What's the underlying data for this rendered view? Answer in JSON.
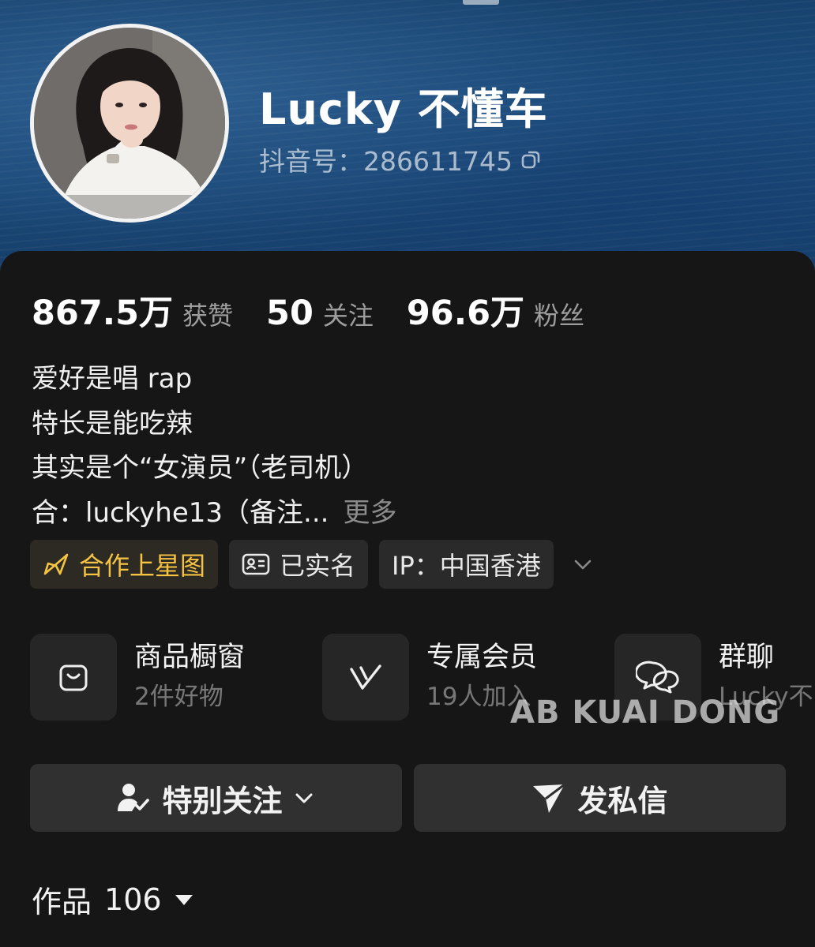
{
  "profile": {
    "nickname": "Lucky 不懂车",
    "douyin_id": "抖音号：286611745",
    "avatar_icon": "profile-photo"
  },
  "stats": [
    {
      "value": "867.5万",
      "label": "获赞"
    },
    {
      "value": "50",
      "label": "关注"
    },
    {
      "value": "96.6万",
      "label": "粉丝"
    }
  ],
  "bio": {
    "lines": [
      "爱好是唱 rap",
      "特长是能吃辣",
      "其实是个“女演员”（老司机）",
      "合：luckyhe13（备注..."
    ],
    "more_label": "更多"
  },
  "tags": [
    {
      "label": "合作上星图",
      "icon": "star-chart-icon",
      "color": "#f5c243"
    },
    {
      "label": "已实名",
      "icon": "id-card-icon"
    },
    {
      "label": "IP：中国香港",
      "icon": ""
    }
  ],
  "services": [
    {
      "title": "商品橱窗",
      "subtitle": "2件好物",
      "icon": "shopping-bag-icon"
    },
    {
      "title": "专属会员",
      "subtitle": "19人加入",
      "icon": "vip-v-icon"
    },
    {
      "title": "群聊",
      "subtitle": "Lucky不",
      "icon": "chat-bubbles-icon"
    }
  ],
  "watermark": "AB KUAI DONG",
  "actions": {
    "follow_label": "特别关注",
    "message_label": "发私信"
  },
  "works": {
    "label": "作品",
    "count": "106"
  },
  "colors": {
    "background": "#161616",
    "accent_gold": "#f5c243",
    "header_blue": "#1b4c7c"
  }
}
